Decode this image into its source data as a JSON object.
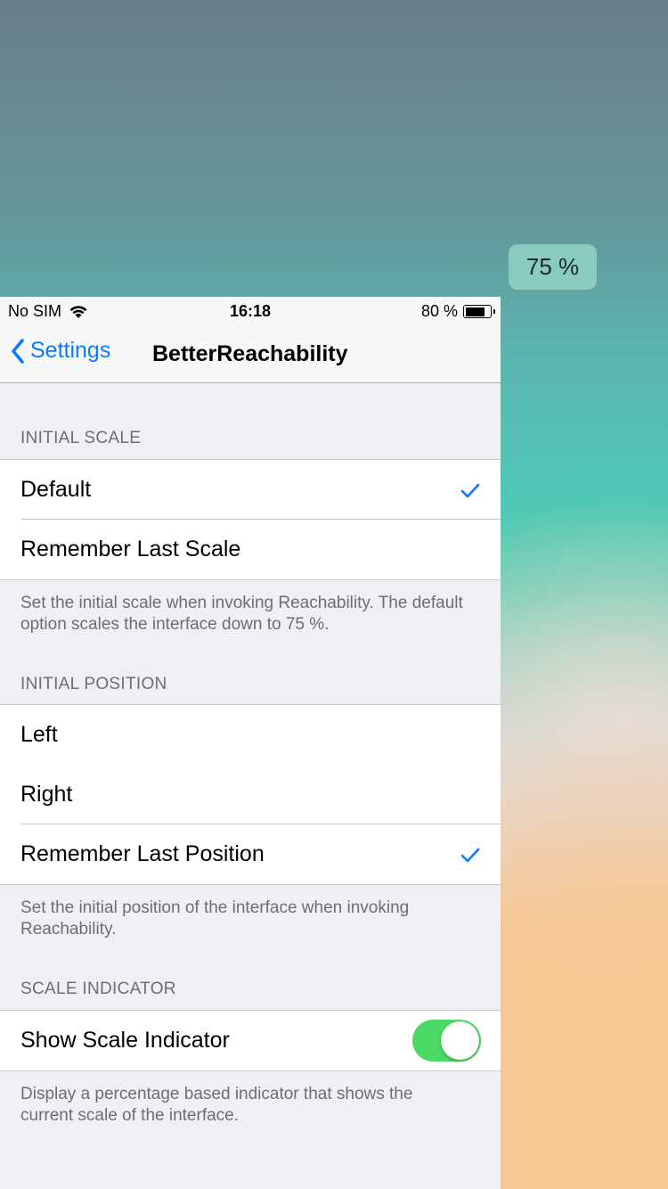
{
  "scale_indicator": "75 %",
  "status_bar": {
    "carrier": "No SIM",
    "time": "16:18",
    "battery_percent": "80 %",
    "battery_level": 0.8
  },
  "nav": {
    "back_label": "Settings",
    "title": "BetterReachability"
  },
  "sections": {
    "initial_scale": {
      "header": "INITIAL SCALE",
      "options": [
        "Default",
        "Remember Last Scale"
      ],
      "selected": "Default",
      "footer": "Set the initial scale when invoking Reachability. The default option scales the interface down to 75 %."
    },
    "initial_position": {
      "header": "INITIAL POSITION",
      "options": [
        "Left",
        "Right",
        "Remember Last Position"
      ],
      "selected": "Remember Last Position",
      "footer": "Set the initial position of the interface when invoking Reachability."
    },
    "scale_indicator": {
      "header": "SCALE INDICATOR",
      "toggle_label": "Show Scale Indicator",
      "toggle_on": true,
      "footer": "Display a percentage based indicator that shows the current scale of the interface."
    }
  },
  "colors": {
    "accent": "#0a7bff",
    "toggle_on": "#4cd964"
  },
  "icons": {
    "wifi": "wifi-icon",
    "battery": "battery-icon",
    "back": "chevron-left-icon",
    "check": "checkmark-icon"
  }
}
